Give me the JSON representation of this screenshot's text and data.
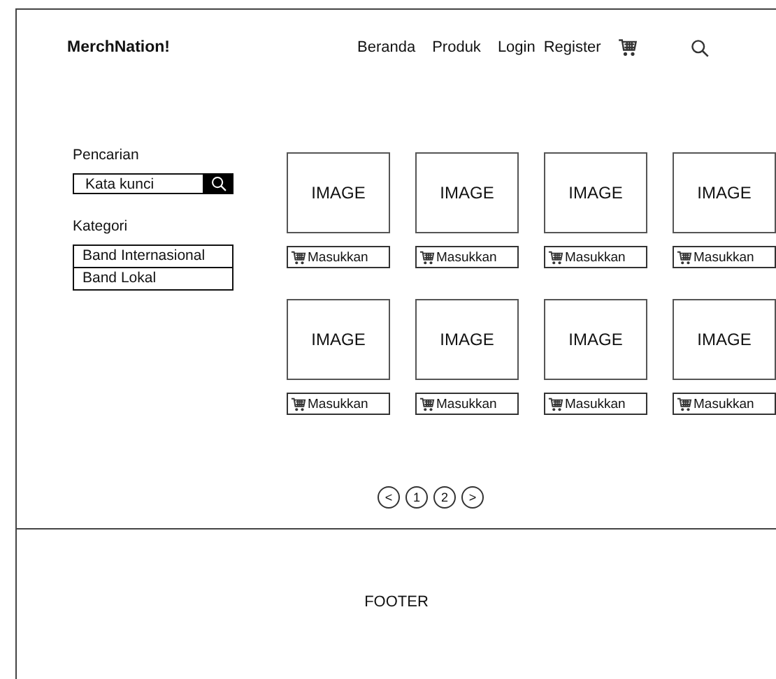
{
  "header": {
    "brand": "MerchNation!",
    "nav": [
      {
        "label": "Beranda"
      },
      {
        "label": "Produk"
      },
      {
        "label": "Login"
      },
      {
        "label": "Register"
      }
    ]
  },
  "sidebar": {
    "search_label": "Pencarian",
    "search": {
      "placeholder": "Kata kunci"
    },
    "category_label": "Kategori",
    "categories": [
      {
        "label": "Band Internasional"
      },
      {
        "label": "Band Lokal"
      }
    ]
  },
  "products": [
    {
      "image_label": "IMAGE",
      "button": "Masukkan"
    },
    {
      "image_label": "IMAGE",
      "button": "Masukkan"
    },
    {
      "image_label": "IMAGE",
      "button": "Masukkan"
    },
    {
      "image_label": "IMAGE",
      "button": "Masukkan"
    },
    {
      "image_label": "IMAGE",
      "button": "Masukkan"
    },
    {
      "image_label": "IMAGE",
      "button": "Masukkan"
    },
    {
      "image_label": "IMAGE",
      "button": "Masukkan"
    },
    {
      "image_label": "IMAGE",
      "button": "Masukkan"
    }
  ],
  "pagination": [
    {
      "label": "<"
    },
    {
      "label": "1"
    },
    {
      "label": "2"
    },
    {
      "label": ">"
    }
  ],
  "footer": "FOOTER"
}
